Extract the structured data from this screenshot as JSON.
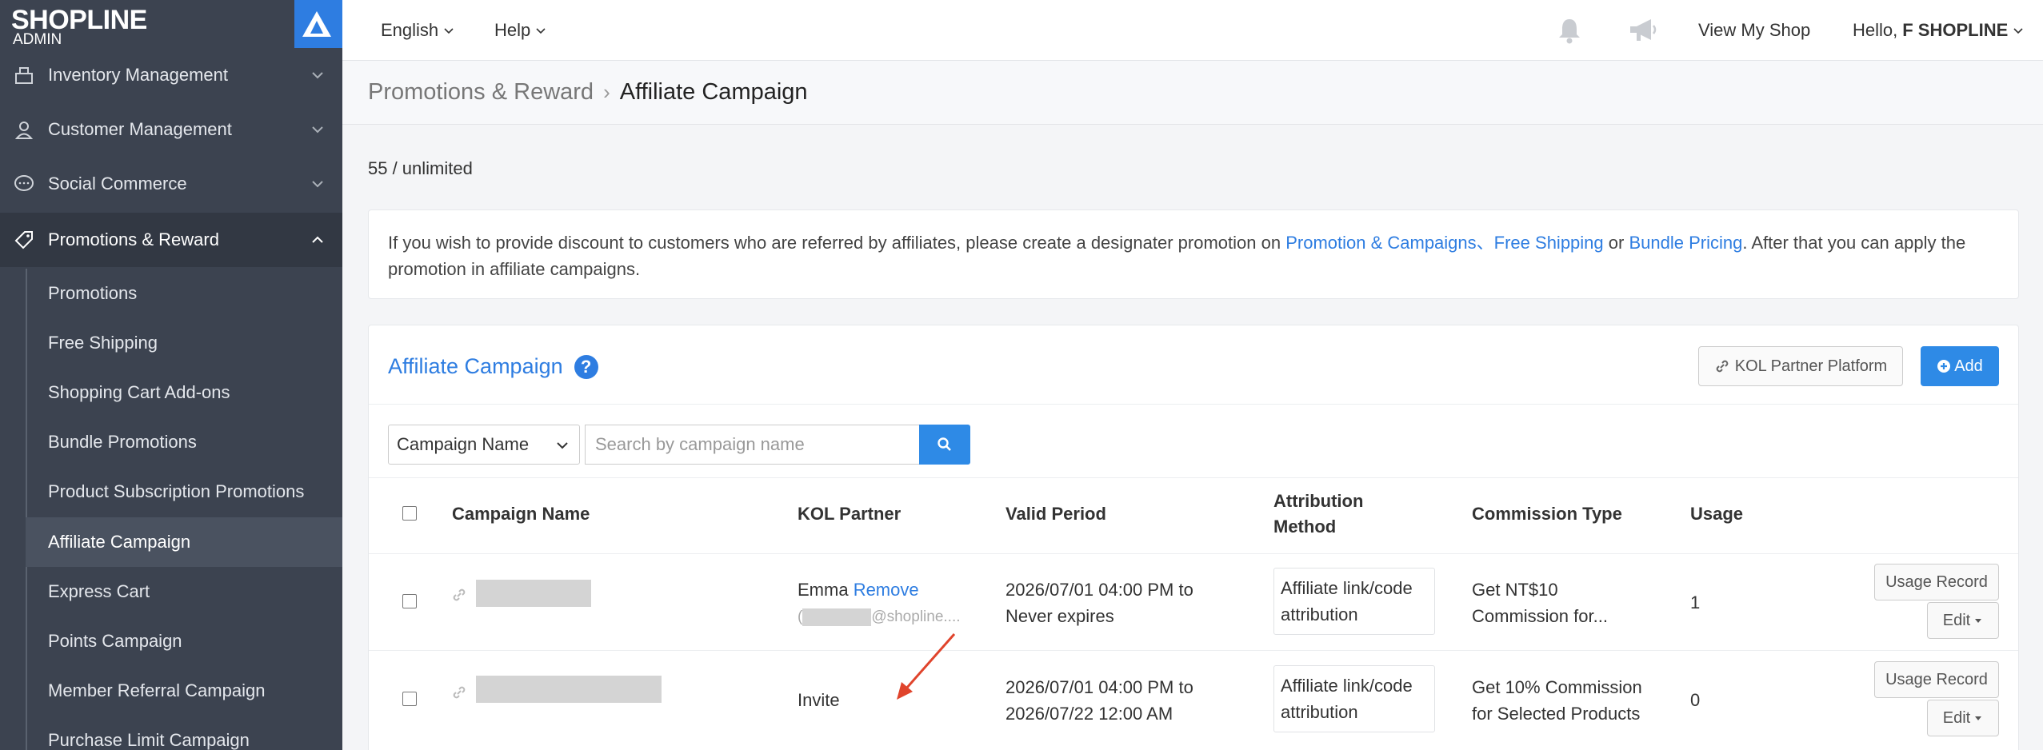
{
  "app": {
    "logo": "SHOPLINE",
    "logo_sub": "ADMIN"
  },
  "sidebar": {
    "sections": [
      {
        "label": "Inventory Management",
        "icon": "inventory-icon"
      },
      {
        "label": "Customer Management",
        "icon": "user-icon"
      },
      {
        "label": "Social Commerce",
        "icon": "chat-icon"
      },
      {
        "label": "Promotions & Reward",
        "icon": "tag-icon"
      }
    ],
    "sub_items": [
      "Promotions",
      "Free Shipping",
      "Shopping Cart Add-ons",
      "Bundle Promotions",
      "Product Subscription Promotions",
      "Affiliate Campaign",
      "Express Cart",
      "Points Campaign",
      "Member Referral Campaign",
      "Purchase Limit Campaign"
    ],
    "active_sub": "Affiliate Campaign"
  },
  "topbar": {
    "language": "English",
    "help": "Help",
    "view_shop": "View My Shop",
    "greeting": "Hello,",
    "user": "F SHOPLINE"
  },
  "breadcrumb": {
    "parent": "Promotions & Reward",
    "separator": "›",
    "current": "Affiliate Campaign"
  },
  "usage": "55 / unlimited",
  "info": {
    "text1": "If you wish to provide discount to customers who are referred by affiliates, please create a designater promotion on ",
    "link1": "Promotion & Campaigns",
    "sep": "、",
    "link2": "Free Shipping",
    "or": " or ",
    "link3": "Bundle Pricing",
    "text2": ". After that you can apply the promotion in affiliate campaigns."
  },
  "card": {
    "title": "Affiliate Campaign",
    "help": "?",
    "kol_button": "KOL Partner Platform",
    "add_button": "Add"
  },
  "filter": {
    "select_value": "Campaign Name",
    "search_placeholder": "Search by campaign name"
  },
  "table": {
    "headers": {
      "name": "Campaign Name",
      "kol": "KOL Partner",
      "period": "Valid Period",
      "attr1": "Attribution",
      "attr2": "Method",
      "commission": "Commission Type",
      "usage": "Usage"
    },
    "rows": [
      {
        "kol_name": "Emma",
        "kol_action": "Remove",
        "kol_email_prefix": "(",
        "kol_email_suffix": "@shopline....",
        "period1": "2026/07/01 04:00 PM to",
        "period2": "Never expires",
        "attr1": "Affiliate link/code",
        "attr2": "attribution",
        "comm1": "Get NT$10",
        "comm2": "Commission for...",
        "usage": "1",
        "usage_record": "Usage Record",
        "edit": "Edit"
      },
      {
        "kol_action": "Invite",
        "period1": "2026/07/01 04:00 PM to",
        "period2": "2026/07/22 12:00 AM",
        "attr1": "Affiliate link/code",
        "attr2": "attribution",
        "comm1": "Get 10% Commission",
        "comm2": "for Selected Products",
        "usage": "0",
        "usage_record": "Usage Record",
        "edit": "Edit"
      }
    ]
  },
  "colors": {
    "accent": "#2e7de1",
    "sidebar": "#3c4350",
    "annotation": "#e0442c"
  }
}
